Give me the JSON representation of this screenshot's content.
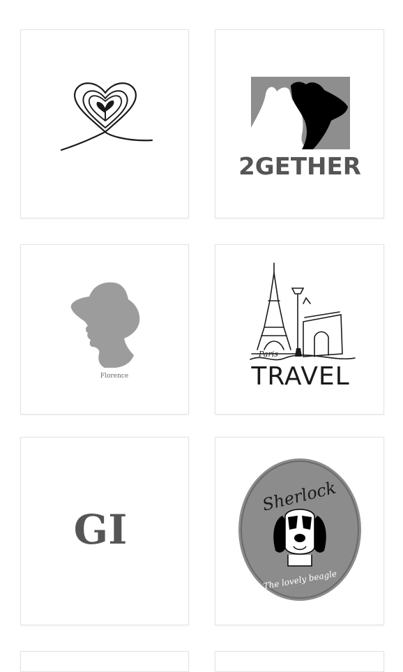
{
  "gallery": {
    "items": [
      {
        "logo_icon": "heart-sprout-icon"
      },
      {
        "logo_text": "2GETHER",
        "logo_icon": "cat-dog-silhouette-icon"
      },
      {
        "logo_text": "Florence",
        "logo_icon": "woman-hat-silhouette-icon"
      },
      {
        "logo_text_script": "Paris",
        "logo_text": "TRAVEL",
        "logo_icon": "eiffel-tower-icon"
      },
      {
        "logo_text": "GI",
        "logo_icon": "monogram-icon"
      },
      {
        "logo_text_top": "Sherlock",
        "logo_text_bottom": "The lovely beagle",
        "logo_icon": "beagle-icon"
      }
    ]
  },
  "colors": {
    "card_border": "#e3e3e3",
    "ink": "#1a1a1a",
    "gray_logo": "#9a9a9a",
    "dark_gray": "#555555"
  }
}
